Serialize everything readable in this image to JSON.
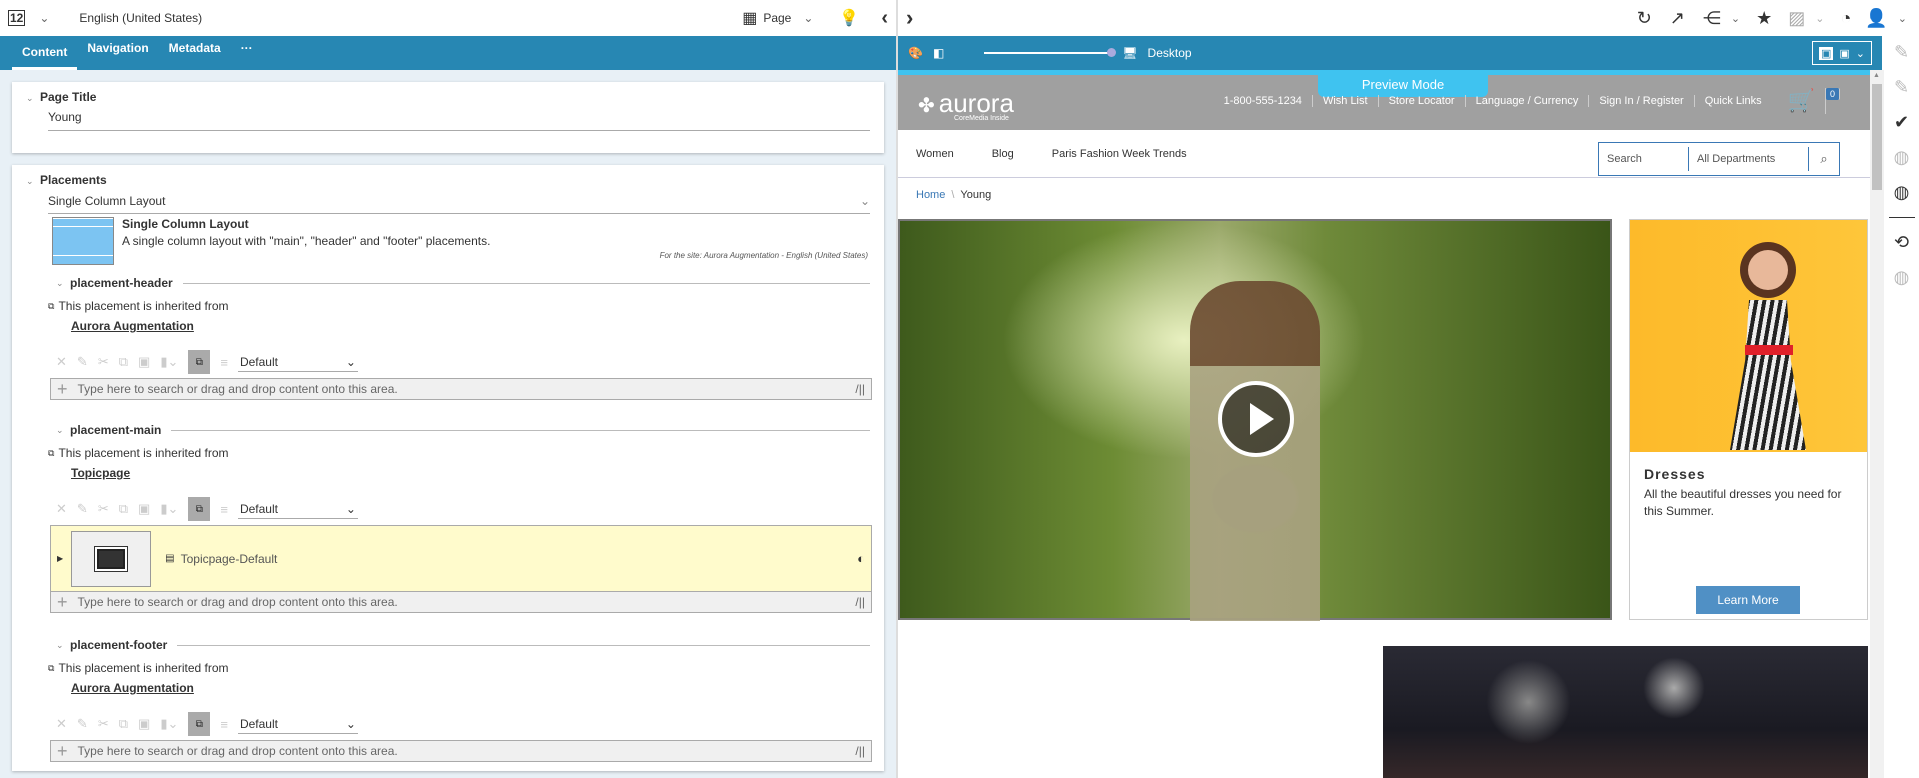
{
  "left": {
    "toolbar": {
      "version_icon": "12",
      "locale": "English (United States)",
      "view": "Page"
    },
    "tabs": [
      {
        "label": "Content"
      },
      {
        "label": "Navigation"
      },
      {
        "label": "Metadata"
      },
      {
        "label": "···"
      }
    ],
    "page_title": {
      "label": "Page Title",
      "value": "Young"
    },
    "placements": {
      "label": "Placements",
      "layout_select": "Single Column Layout",
      "layout_name": "Single Column Layout",
      "layout_desc": "A single column layout with \"main\", \"header\" and \"footer\" placements.",
      "site_note": "For the site: Aurora Augmentation - English (United States)",
      "items": [
        {
          "name": "placement-header",
          "inherited": "This placement is inherited from",
          "source": "Aurora Augmentation",
          "view": "Default",
          "drop": "Type here to search or drag and drop content onto this area."
        },
        {
          "name": "placement-main",
          "inherited": "This placement is inherited from",
          "source": "Topicpage",
          "view": "Default",
          "content": "Topicpage-Default",
          "drop": "Type here to search or drag and drop content onto this area."
        },
        {
          "name": "placement-footer",
          "inherited": "This placement is inherited from",
          "source": "Aurora Augmentation",
          "view": "Default",
          "drop": "Type here to search or drag and drop content onto this area."
        }
      ]
    }
  },
  "right": {
    "device": "Desktop",
    "preview_mode": "Preview Mode",
    "site": {
      "logo": "aurora",
      "logo_sub": "CoreMedia Inside",
      "top_links": [
        "1-800-555-1234",
        "Wish List",
        "Store Locator",
        "Language / Currency",
        "Sign In / Register",
        "Quick Links"
      ],
      "cart_count": "0",
      "nav": [
        "Women",
        "Blog",
        "Paris Fashion Week Trends"
      ],
      "search_placeholder": "Search",
      "departments": "All Departments",
      "breadcrumb": [
        "Home",
        "Young"
      ],
      "teaser": {
        "title": "Dresses",
        "text": "All the beautiful dresses you need for this Summer.",
        "button": "Learn More"
      }
    }
  },
  "colors": {
    "accent": "#2787b3",
    "preview": "#3fc3f0",
    "button": "#5090c5",
    "highlight": "#fffbcc"
  }
}
